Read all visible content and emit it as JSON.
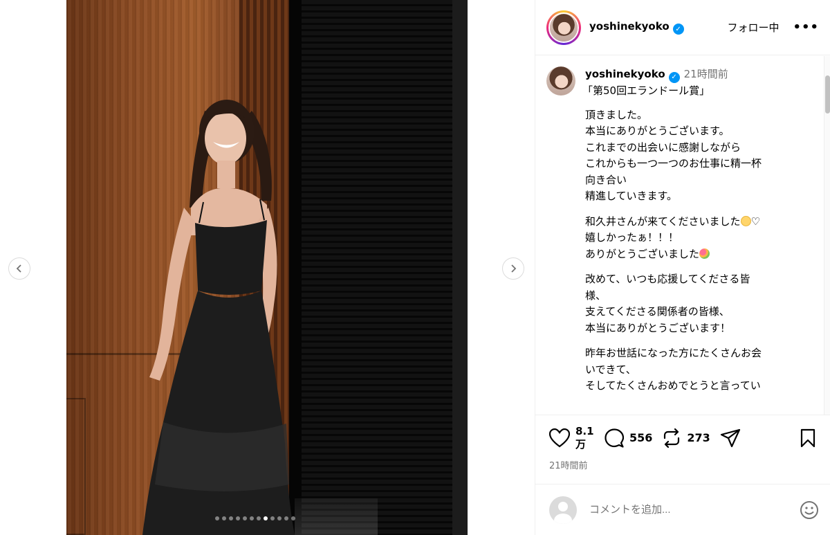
{
  "post": {
    "username": "yoshinekyoko",
    "follow_state": "フォロー中",
    "more": "•••",
    "verified_mark": "✓"
  },
  "caption": {
    "username": "yoshinekyoko",
    "time": "21時間前",
    "title": "「第50回エランドール賞」",
    "lines": [
      "頂きました。\n本当にありがとうございます。\nこれまでの出会いに感謝しながら\nこれからも一つ一つのお仕事に精一杯\n向き合い\n精進していきます。",
      "和久井さんが来てくださいました",
      "♡\n嬉しかったぁ！！！\nありがとうございました",
      "改めて、いつも応援してくださる皆\n様、\n支えてくださる関係者の皆様、\n本当にありがとうございます！",
      "昨年お世話になった方にたくさんお会\nいできて、\nそしてたくさんおめでとうと言ってい"
    ]
  },
  "actions": {
    "likes": "8.1\n万",
    "comments": "556",
    "reposts": "273",
    "time": "21時間前"
  },
  "comment_box": {
    "placeholder": "コメントを追加..."
  },
  "carousel": {
    "count": 12,
    "active_index": 7
  },
  "colors": {
    "verified": "#0095f6",
    "muted": "#737373",
    "border": "#efefef"
  }
}
